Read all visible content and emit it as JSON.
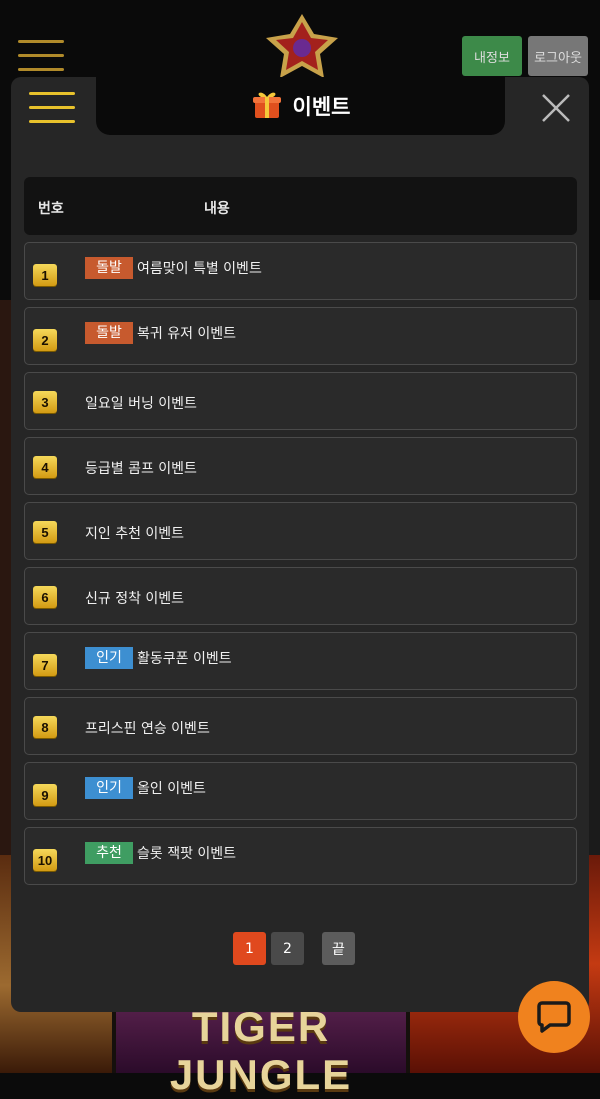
{
  "header": {
    "my_info_label": "내정보",
    "logout_label": "로그아웃"
  },
  "background": {
    "game_banner_text": "TIGER JUNGLE"
  },
  "modal": {
    "title": "이벤트",
    "columns": {
      "number": "번호",
      "content": "내용"
    },
    "rows": [
      {
        "num": "1",
        "badge": "돌발",
        "badge_color": "#c75a2e",
        "title": "여름맞이 특별 이벤트"
      },
      {
        "num": "2",
        "badge": "돌발",
        "badge_color": "#c75a2e",
        "title": "복귀 유저 이벤트"
      },
      {
        "num": "3",
        "badge": "",
        "badge_color": "",
        "title": "일요일 버닝 이벤트"
      },
      {
        "num": "4",
        "badge": "",
        "badge_color": "",
        "title": "등급별 콤프 이벤트"
      },
      {
        "num": "5",
        "badge": "",
        "badge_color": "",
        "title": "지인 추천 이벤트"
      },
      {
        "num": "6",
        "badge": "",
        "badge_color": "",
        "title": "신규 정착 이벤트"
      },
      {
        "num": "7",
        "badge": "인기",
        "badge_color": "#3d8fd1",
        "title": "활동쿠폰 이벤트"
      },
      {
        "num": "8",
        "badge": "",
        "badge_color": "",
        "title": "프리스핀 연승 이벤트"
      },
      {
        "num": "9",
        "badge": "인기",
        "badge_color": "#3d8fd1",
        "title": "올인 이벤트"
      },
      {
        "num": "10",
        "badge": "추천",
        "badge_color": "#3f9d62",
        "title": "슬롯 잭팟 이벤트"
      }
    ],
    "pagination": {
      "page1": "1",
      "page2": "2",
      "last": "끝"
    }
  },
  "colors": {
    "accent": "#e8c22c",
    "active_page": "#e0491e",
    "chat_button": "#f0821e"
  },
  "icons": [
    "hamburger-menu-icon",
    "gift-icon",
    "close-icon",
    "chat-icon"
  ]
}
